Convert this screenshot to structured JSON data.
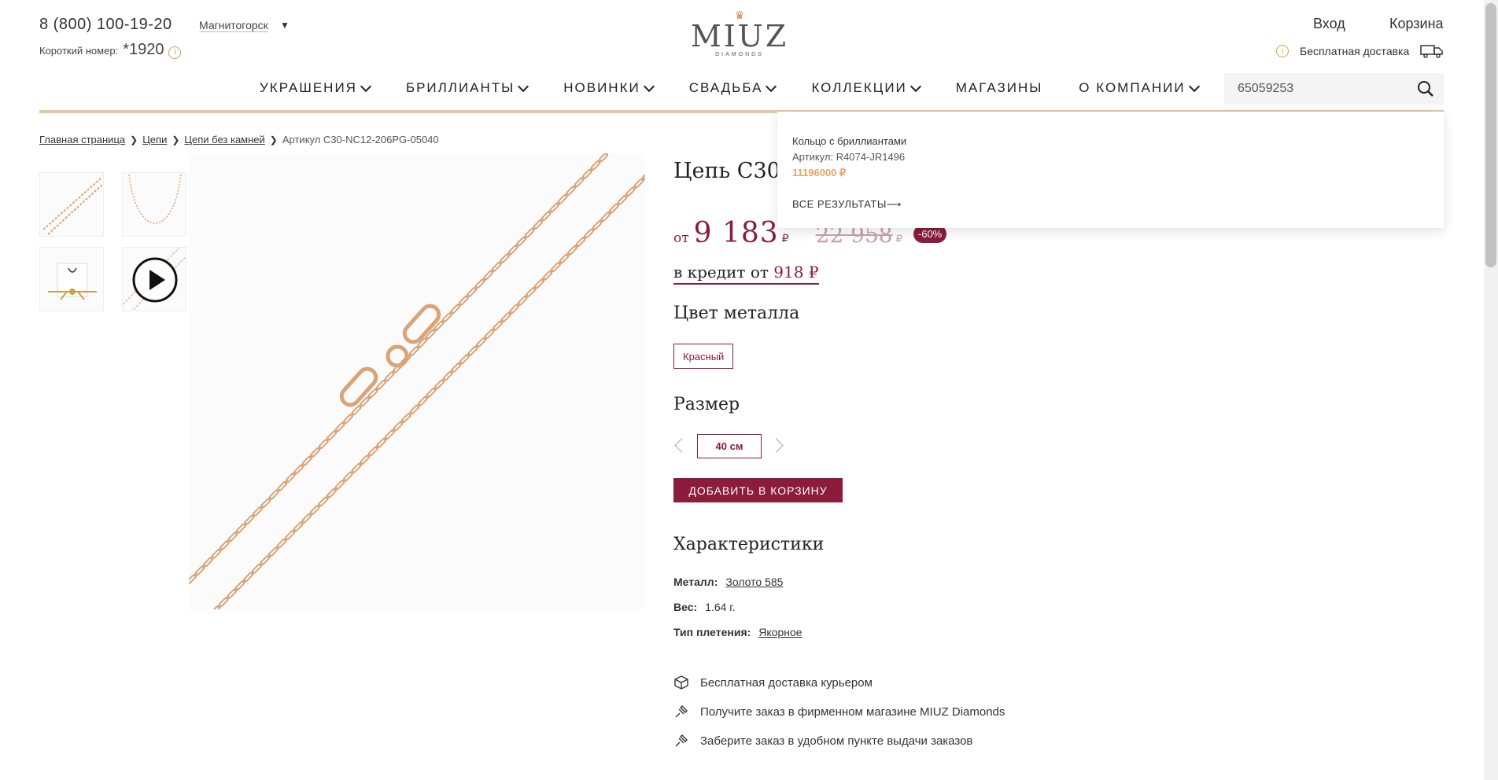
{
  "header": {
    "phone": "8 (800) 100-19-20",
    "short_label": "Короткий номер:",
    "short_number": "*1920",
    "city": "Магнитогорск",
    "logo_name": "MIUZ",
    "logo_sub": "DIAMONDS",
    "login": "Вход",
    "cart": "Корзина",
    "delivery": "Бесплатная доставка"
  },
  "nav": {
    "items": [
      {
        "label": "УКРАШЕНИЯ",
        "has_menu": true
      },
      {
        "label": "БРИЛЛИАНТЫ",
        "has_menu": true
      },
      {
        "label": "НОВИНКИ",
        "has_menu": true
      },
      {
        "label": "СВАДЬБА",
        "has_menu": true
      },
      {
        "label": "КОЛЛЕКЦИИ",
        "has_menu": true
      },
      {
        "label": "МАГАЗИНЫ",
        "has_menu": false
      },
      {
        "label": "О КОМПАНИИ",
        "has_menu": true
      }
    ],
    "search_value": "65059253"
  },
  "search_dropdown": {
    "result_name": "Кольцо с бриллиантами",
    "result_article": "Артикул: R4074-JR1496",
    "result_price": "11196000 ₽",
    "all_results": "ВСЕ РЕЗУЛЬТАТЫ⟶"
  },
  "breadcrumb": {
    "items": [
      "Главная страница",
      "Цепи",
      "Цепи без камней"
    ],
    "current": "Артикул C30-NC12-206PG-05040"
  },
  "product": {
    "title": "Цепь C30",
    "price_from": "от",
    "price": "9 183",
    "currency": "₽",
    "old_price": "22 958",
    "discount": "-60%",
    "credit_label": "в кредит от",
    "credit_value": "918 ₽",
    "color_heading": "Цвет металла",
    "color_value": "Красный",
    "size_heading": "Размер",
    "size_value": "40 см",
    "add_to_cart": "ДОБАВИТЬ В КОРЗИНУ",
    "specs_heading": "Характеристики",
    "specs": [
      {
        "key": "Металл:",
        "value": "Золото 585"
      },
      {
        "key": "Вес:",
        "value": "1.64 г."
      },
      {
        "key": "Тип плетения:",
        "value": "Якорное"
      }
    ],
    "perks": [
      "Бесплатная доставка курьером",
      "Получите заказ в фирменном магазине MIUZ Diamonds",
      "Заберите заказ в удобном пункте выдачи заказов"
    ]
  },
  "colors": {
    "accent": "#8b1c3b",
    "gold": "#e3c8a3",
    "chain": "#d9a47a"
  }
}
